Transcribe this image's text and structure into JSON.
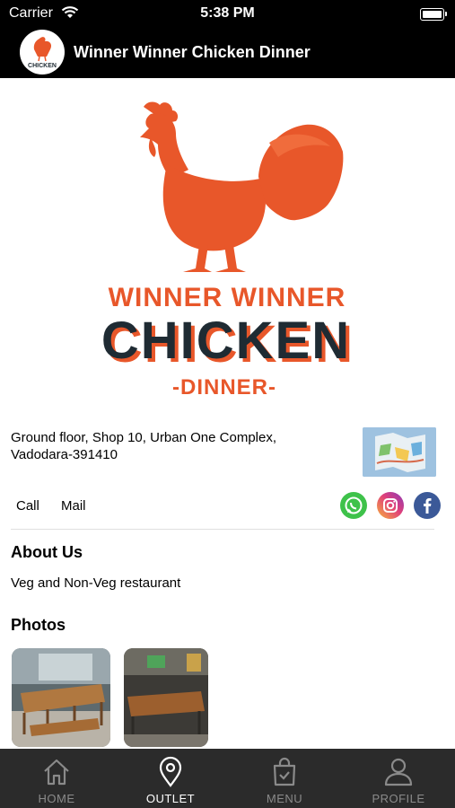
{
  "status_bar": {
    "carrier": "Carrier",
    "time": "5:38 PM"
  },
  "navbar": {
    "title": "Winner Winner Chicken Dinner",
    "avatar_text": "CHICKEN"
  },
  "logo": {
    "line1": "WINNER WINNER",
    "line2": "CHICKEN",
    "line3": "-DINNER-"
  },
  "address": {
    "line1": "Ground floor, Shop 10,  Urban One Complex,",
    "line2": "Vadodara-391410"
  },
  "actions": {
    "call": "Call",
    "mail": "Mail"
  },
  "social_icons": [
    "whatsapp-icon",
    "instagram-icon",
    "facebook-icon"
  ],
  "about": {
    "heading": "About Us",
    "text": "Veg and Non-Veg restaurant"
  },
  "photos": {
    "heading": "Photos"
  },
  "tabs": [
    {
      "label": "HOME",
      "icon": "home-icon"
    },
    {
      "label": "OUTLET",
      "icon": "location-pin-icon",
      "active": true
    },
    {
      "label": "MENU",
      "icon": "shopping-bag-icon"
    },
    {
      "label": "PROFILE",
      "icon": "person-icon"
    }
  ],
  "colors": {
    "brand_orange": "#e8572a",
    "brand_dark": "#1f2b33",
    "tab_bar": "#2b2b2b"
  }
}
